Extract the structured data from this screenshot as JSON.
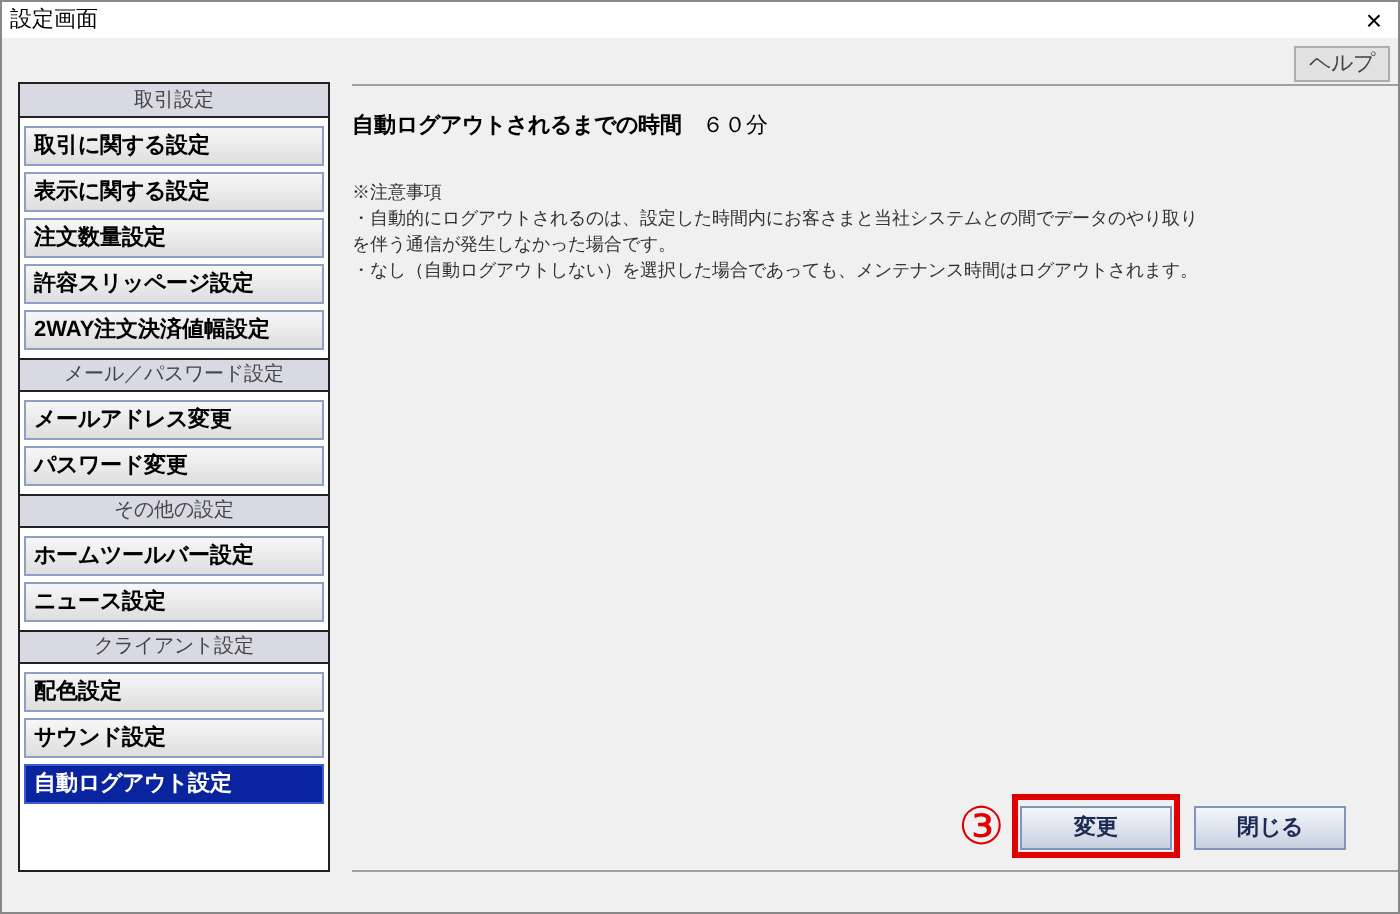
{
  "window": {
    "title": "設定画面",
    "close": "×"
  },
  "help_button": "ヘルプ",
  "sidebar": {
    "sections": [
      {
        "title": "取引設定",
        "items": [
          {
            "label": "取引に関する設定",
            "selected": false
          },
          {
            "label": "表示に関する設定",
            "selected": false
          },
          {
            "label": "注文数量設定",
            "selected": false
          },
          {
            "label": "許容スリッページ設定",
            "selected": false
          },
          {
            "label": "2WAY注文決済値幅設定",
            "selected": false
          }
        ]
      },
      {
        "title": "メール／パスワード設定",
        "items": [
          {
            "label": "メールアドレス変更",
            "selected": false
          },
          {
            "label": "パスワード変更",
            "selected": false
          }
        ]
      },
      {
        "title": "その他の設定",
        "items": [
          {
            "label": "ホームツールバー設定",
            "selected": false
          },
          {
            "label": "ニュース設定",
            "selected": false
          }
        ]
      },
      {
        "title": "クライアント設定",
        "items": [
          {
            "label": "配色設定",
            "selected": false
          },
          {
            "label": "サウンド設定",
            "selected": false
          },
          {
            "label": "自動ログアウト設定",
            "selected": true
          }
        ]
      }
    ]
  },
  "setting": {
    "label": "自動ログアウトされるまでの時間",
    "value": "６０分"
  },
  "notes": {
    "heading": "※注意事項",
    "lines": [
      "・自動的にログアウトされるのは、設定した時間内にお客さまと当社システムとの間でデータのやり取り",
      "を伴う通信が発生しなかった場合です。",
      "・なし（自動ログアウトしない）を選択した場合であっても、メンテナンス時間はログアウトされます。"
    ]
  },
  "buttons": [
    {
      "label": "変更",
      "highlighted": true,
      "annotation": "③"
    },
    {
      "label": "閉じる",
      "highlighted": false
    }
  ]
}
